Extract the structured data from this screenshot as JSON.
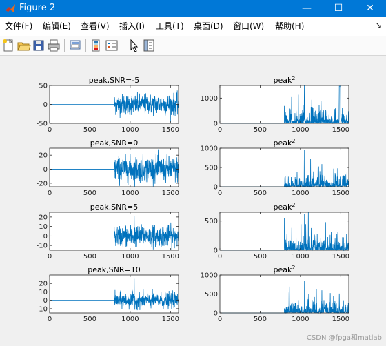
{
  "window": {
    "title": "Figure 2",
    "buttons": {
      "minimize": "—",
      "maximize": "☐",
      "close": "✕"
    }
  },
  "menu": {
    "items": [
      "文件(F)",
      "编辑(E)",
      "查看(V)",
      "插入(I)",
      "工具(T)",
      "桌面(D)",
      "窗口(W)",
      "帮助(H)"
    ],
    "pin": "↘"
  },
  "toolbar": {
    "icons": [
      "new-figure-icon",
      "open-file-icon",
      "save-icon",
      "print-icon",
      "link-plot-icon",
      "insert-colorbar-icon",
      "insert-legend-icon",
      "edit-plot-cursor-icon",
      "property-inspector-icon"
    ]
  },
  "watermark": "CSDN @fpga和matlab",
  "colors": {
    "line": "#0072bd",
    "axes_bg": "#ffffff",
    "figure_bg": "#f0f0f0",
    "titlebar": "#0078d7"
  },
  "chart_data": [
    {
      "type": "line",
      "title": "peak,SNR=-5",
      "xlim": [
        0,
        1600
      ],
      "ylim": [
        -50,
        50
      ],
      "xticks": [
        0,
        500,
        1000,
        1500
      ],
      "yticks": [
        -50,
        0,
        50
      ],
      "signal": "zero for x<800, noise amplitude ~30 after 800",
      "x_onset": 800,
      "approx_amplitude": 30
    },
    {
      "type": "line",
      "title": "peak",
      "title_superscript": "2",
      "xlim": [
        0,
        1600
      ],
      "ylim": [
        0,
        1500
      ],
      "xticks": [
        0,
        500,
        1000,
        1500
      ],
      "yticks": [
        0,
        1000
      ],
      "signal": "zero for x<800, squared noise after 800",
      "x_onset": 800,
      "approx_peak": 1500
    },
    {
      "type": "line",
      "title": "peak,SNR=0",
      "xlim": [
        0,
        1600
      ],
      "ylim": [
        -25,
        30
      ],
      "xticks": [
        0,
        500,
        1000,
        1500
      ],
      "yticks": [
        -20,
        0,
        20
      ],
      "signal": "zero for x<800, noise amplitude ~20 after 800",
      "x_onset": 800,
      "approx_amplitude": 20
    },
    {
      "type": "line",
      "title": "peak",
      "title_superscript": "2",
      "xlim": [
        0,
        1600
      ],
      "ylim": [
        0,
        1000
      ],
      "xticks": [
        0,
        500,
        1000,
        1500
      ],
      "yticks": [
        0,
        500,
        1000
      ],
      "signal": "zero for x<800, squared noise after 800, spike near x=1050",
      "x_onset": 800,
      "spike_x": 1050,
      "approx_peak": 950
    },
    {
      "type": "line",
      "title": "peak,SNR=5",
      "xlim": [
        0,
        1600
      ],
      "ylim": [
        -15,
        25
      ],
      "xticks": [
        0,
        500,
        1000,
        1500
      ],
      "yticks": [
        -10,
        0,
        10,
        20
      ],
      "signal": "zero for x<800, noise amplitude ~12 after 800, spike near x=1050",
      "x_onset": 800,
      "approx_amplitude": 12,
      "spike_x": 1050
    },
    {
      "type": "line",
      "title": "peak",
      "title_superscript": "2",
      "xlim": [
        0,
        1600
      ],
      "ylim": [
        0,
        650
      ],
      "xticks": [
        0,
        500,
        1000,
        1500
      ],
      "yticks": [
        0,
        500
      ],
      "signal": "zero for x<800, squared noise after 800, spike near x=1050",
      "x_onset": 800,
      "spike_x": 1050,
      "approx_peak": 620
    },
    {
      "type": "line",
      "title": "peak,SNR=10",
      "xlim": [
        0,
        1600
      ],
      "ylim": [
        -15,
        30
      ],
      "xticks": [
        0,
        500,
        1000,
        1500
      ],
      "yticks": [
        -10,
        0,
        10,
        20
      ],
      "signal": "zero for x<800, noise amplitude ~10 after 800, spike near x=1050",
      "x_onset": 800,
      "approx_amplitude": 10,
      "spike_x": 1050
    },
    {
      "type": "line",
      "title": "peak",
      "title_superscript": "2",
      "xlim": [
        0,
        1600
      ],
      "ylim": [
        0,
        1000
      ],
      "xticks": [
        0,
        500,
        1000,
        1500
      ],
      "yticks": [
        0,
        500,
        1000
      ],
      "signal": "zero for x<800, squared noise after 800, spike near x=1050",
      "x_onset": 800,
      "spike_x": 1050,
      "approx_peak": 850
    }
  ]
}
